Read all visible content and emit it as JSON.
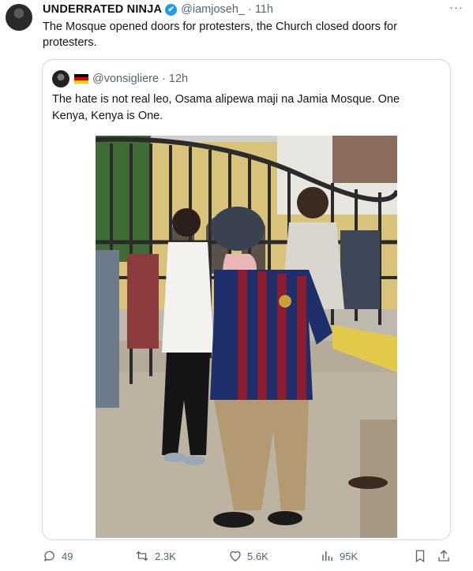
{
  "tweet": {
    "display_name": "UNDERRATED NINJA",
    "verified_mark": "✔",
    "handle": "@iamjoseh_",
    "separator": "·",
    "time": "11h",
    "more": "···",
    "text": "The Mosque opened doors for protesters, the Church closed doors for protesters."
  },
  "quote": {
    "handle": "@vonsigliere",
    "separator": "·",
    "time": "12h",
    "flag": "germany-flag",
    "text": "The hate is not real leo, Osama alipewa maji na Jamia Mosque. One Kenya, Kenya is One."
  },
  "actions": {
    "replies": "49",
    "reposts": "2.3K",
    "likes": "5.6K",
    "views": "95K"
  },
  "colors": {
    "accent": "#1d9bf0",
    "muted": "#536471",
    "border": "#cfd9de"
  }
}
